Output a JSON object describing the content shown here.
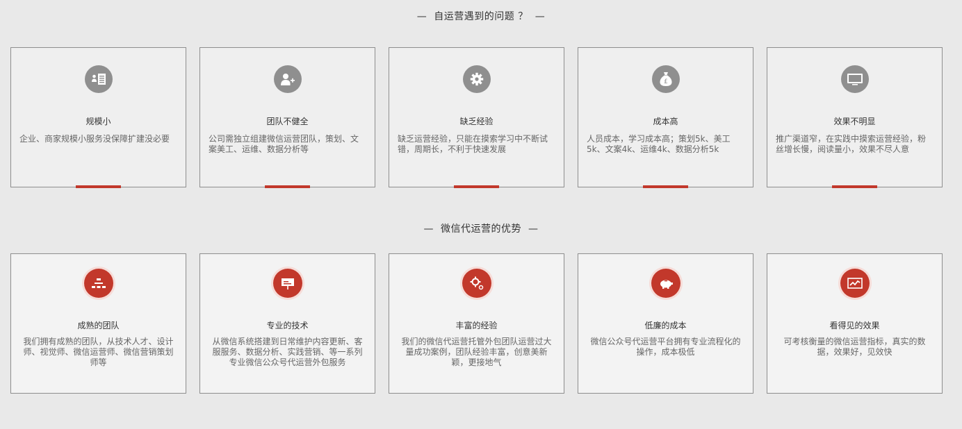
{
  "section1": {
    "title": "自运营遇到的问题 ？",
    "cards": [
      {
        "icon": "id-card-icon",
        "title": "规模小",
        "desc": "企业、商家规模小服务没保障扩建没必要"
      },
      {
        "icon": "add-user-icon",
        "title": "团队不健全",
        "desc": "公司需独立组建微信运营团队，策划、文案美工、运维、数据分析等"
      },
      {
        "icon": "gear-icon",
        "title": "缺乏经验",
        "desc": "缺乏运营经验，只能在摸索学习中不断试错，周期长，不利于快速发展"
      },
      {
        "icon": "money-bag-icon",
        "title": "成本高",
        "desc": "人员成本，学习成本高；策划5k、美工5k、文案4k、运维4k、数据分析5k"
      },
      {
        "icon": "monitor-icon",
        "title": "效果不明显",
        "desc": "推广渠道窄，在实践中摸索运营经验，粉丝增长慢，阅读量小，效果不尽人意"
      }
    ]
  },
  "section2": {
    "title": "微信代运营的优势",
    "cards": [
      {
        "icon": "org-chart-icon",
        "title": "成熟的团队",
        "desc": "我们拥有成熟的团队，从技术人才、设计师、视觉师、微信运营师、微信营销策划师等"
      },
      {
        "icon": "presentation-board-icon",
        "title": "专业的技术",
        "desc": "从微信系统搭建到日常维护内容更新、客服服务、数据分析、实践营销、等一系列专业微信公众号代运营外包服务"
      },
      {
        "icon": "gears-icon",
        "title": "丰富的经验",
        "desc": "我们的微信代运营托管外包团队运营过大量成功案例，团队经验丰富，创意美新颖，更接地气"
      },
      {
        "icon": "piggy-bank-icon",
        "title": "低廉的成本",
        "desc": "微信公众号代运营平台拥有专业流程化的操作，成本极低"
      },
      {
        "icon": "trend-chart-icon",
        "title": "看得见的效果",
        "desc": "可考核衡量的微信运营指标，真实的数据，效果好，见效快"
      }
    ]
  },
  "colors": {
    "accent": "#c2382b",
    "icon_gray": "#8f8f8f",
    "background": "#e9e9e9"
  }
}
